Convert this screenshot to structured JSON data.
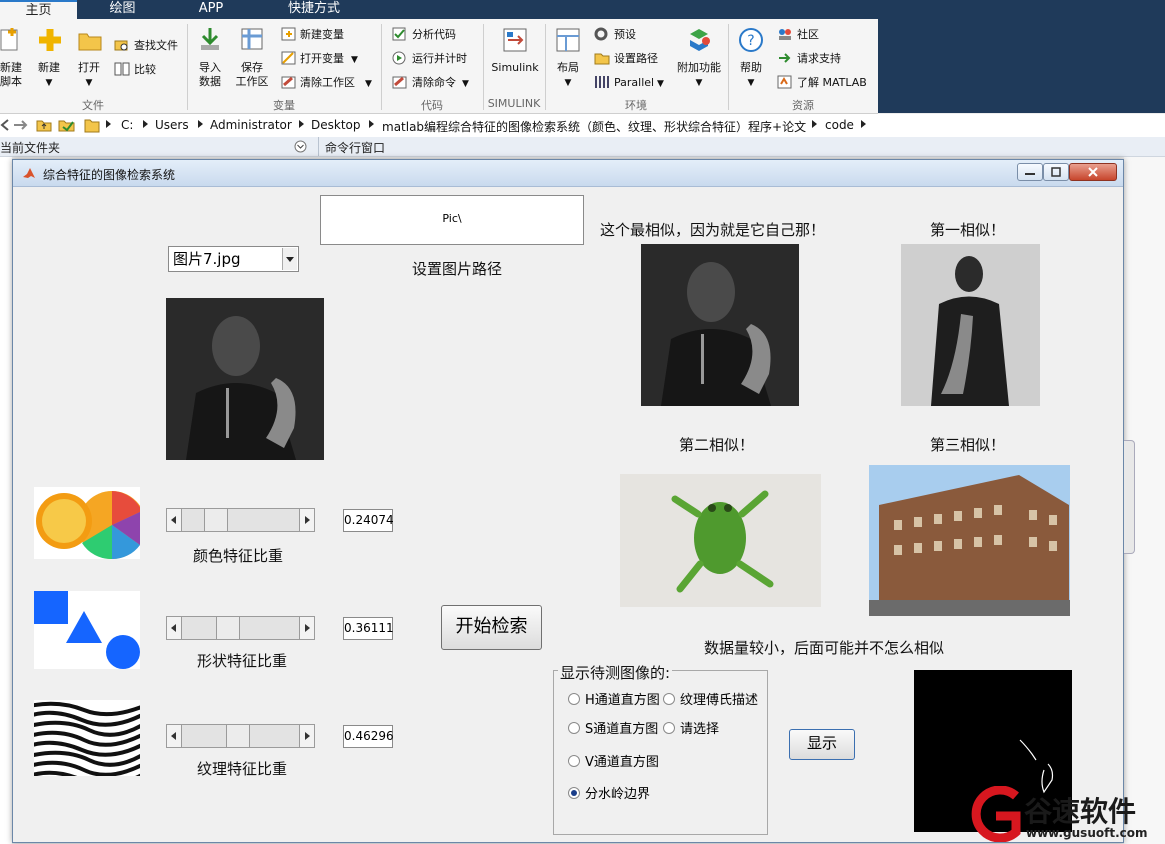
{
  "tabs": [
    "主页",
    "绘图",
    "APP",
    "快捷方式"
  ],
  "ribbon": {
    "file": {
      "new_script": "新建\n脚本",
      "new": "新建",
      "open": "打开",
      "find_files": "查找文件",
      "compare": "比较",
      "group": "文件"
    },
    "variable": {
      "import": "导入\n数据",
      "save_ws": "保存\n工作区",
      "new_var": "新建变量",
      "open_var": "打开变量",
      "clear_ws": "清除工作区",
      "group": "变量"
    },
    "code": {
      "analyze": "分析代码",
      "run_time": "运行并计时",
      "clear_cmd": "清除命令",
      "group": "代码"
    },
    "simulink": {
      "label": "Simulink",
      "group": "SIMULINK"
    },
    "env": {
      "layout": "布局",
      "prefs": "预设",
      "set_path": "设置路径",
      "parallel": "Parallel",
      "addons": "附加功能",
      "group": "环境"
    },
    "resources": {
      "help": "帮助",
      "community": "社区",
      "support": "请求支持",
      "learn": "了解 MATLAB",
      "group": "资源"
    }
  },
  "address": [
    "C:",
    "Users",
    "Administrator",
    "Desktop",
    "matlab编程综合特征的图像检索系统（颜色、纹理、形状综合特征）程序+论文",
    "code"
  ],
  "panels": {
    "current_folder": "当前文件夹",
    "command_window": "命令行窗口"
  },
  "figure": {
    "title": "综合特征的图像检索系统",
    "path_value": "Pic\\",
    "path_label": "设置图片路径",
    "selected_image": "图片7.jpg",
    "result_self": "这个最相似，因为就是它自己那！",
    "result_1": "第一相似！",
    "result_2": "第二相似！",
    "result_3": "第三相似！",
    "note": "数据量较小，后面可能并不怎么相似",
    "color_label": "颜色特征比重",
    "shape_label": "形状特征比重",
    "texture_label": "纹理特征比重",
    "color_value": "0.24074",
    "shape_value": "0.36111",
    "texture_value": "0.46296",
    "search_button": "开始检索",
    "display_group": "显示待测图像的:",
    "radios": [
      "H通道直方图",
      "纹理傅氏描述",
      "S通道直方图",
      "请选择",
      "V通道直方图",
      "分水岭边界"
    ],
    "show_button": "显示"
  },
  "sliders": {
    "color": 0.24074,
    "shape": 0.36111,
    "texture": 0.46296
  },
  "watermark": {
    "brand": "谷速软件",
    "url": "www.gusuoft.com"
  },
  "colors": {
    "tabbar": "#1f3a5a",
    "accent": "#2a79c9",
    "brand_red": "#d7171f"
  }
}
